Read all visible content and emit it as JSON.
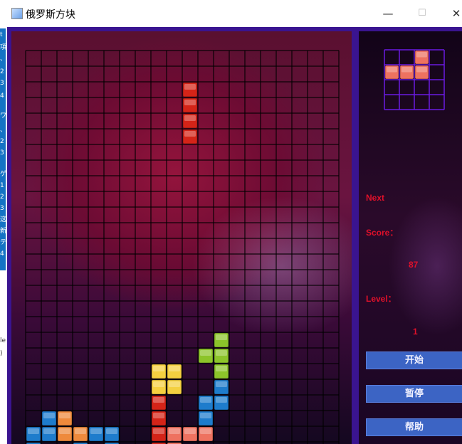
{
  "window": {
    "title": "俄罗斯方块",
    "minimize_glyph": "—",
    "maximize_glyph": "☐",
    "close_glyph": "✕",
    "icon": "java-cup-icon"
  },
  "background_window": {
    "fragments": [
      "t",
      "項",
      "、",
      "2",
      "3",
      "4",
      "ワ",
      "、",
      "2",
      "3",
      "ゲ",
      "1",
      "2",
      "3",
      "这",
      "新",
      "テ",
      "4"
    ],
    "lower_fragments": [
      "le",
      ")"
    ]
  },
  "board": {
    "cols": 20,
    "rows": 26,
    "blocks": [
      {
        "r": 2,
        "c": 10,
        "color": "red"
      },
      {
        "r": 3,
        "c": 10,
        "color": "red"
      },
      {
        "r": 4,
        "c": 10,
        "color": "red"
      },
      {
        "r": 5,
        "c": 10,
        "color": "red"
      },
      {
        "r": 18,
        "c": 12,
        "color": "green"
      },
      {
        "r": 19,
        "c": 11,
        "color": "green"
      },
      {
        "r": 19,
        "c": 12,
        "color": "green"
      },
      {
        "r": 20,
        "c": 12,
        "color": "green"
      },
      {
        "r": 20,
        "c": 8,
        "color": "yellow"
      },
      {
        "r": 20,
        "c": 9,
        "color": "yellow"
      },
      {
        "r": 21,
        "c": 8,
        "color": "yellow"
      },
      {
        "r": 21,
        "c": 9,
        "color": "yellow"
      },
      {
        "r": 21,
        "c": 12,
        "color": "blue"
      },
      {
        "r": 22,
        "c": 11,
        "color": "blue"
      },
      {
        "r": 22,
        "c": 12,
        "color": "blue"
      },
      {
        "r": 23,
        "c": 11,
        "color": "blue"
      },
      {
        "r": 22,
        "c": 8,
        "color": "red"
      },
      {
        "r": 23,
        "c": 8,
        "color": "red"
      },
      {
        "r": 24,
        "c": 8,
        "color": "red"
      },
      {
        "r": 24,
        "c": 9,
        "color": "salmon"
      },
      {
        "r": 24,
        "c": 10,
        "color": "salmon"
      },
      {
        "r": 24,
        "c": 11,
        "color": "salmon"
      },
      {
        "r": 23,
        "c": 1,
        "color": "blue"
      },
      {
        "r": 23,
        "c": 2,
        "color": "orange"
      },
      {
        "r": 24,
        "c": 0,
        "color": "blue"
      },
      {
        "r": 24,
        "c": 1,
        "color": "blue"
      },
      {
        "r": 24,
        "c": 2,
        "color": "orange"
      },
      {
        "r": 24,
        "c": 3,
        "color": "orange"
      },
      {
        "r": 24,
        "c": 4,
        "color": "blue"
      },
      {
        "r": 24,
        "c": 5,
        "color": "blue"
      },
      {
        "r": 25,
        "c": 0,
        "color": "blue"
      },
      {
        "r": 25,
        "c": 3,
        "color": "blue"
      },
      {
        "r": 25,
        "c": 5,
        "color": "blue"
      },
      {
        "r": 25,
        "c": 8,
        "color": "red"
      },
      {
        "r": 25,
        "c": 9,
        "color": "salmon"
      }
    ]
  },
  "preview": {
    "cols": 4,
    "rows": 3,
    "blocks": [
      {
        "r": 0,
        "c": 2,
        "color": "salmon"
      },
      {
        "r": 1,
        "c": 0,
        "color": "salmon"
      },
      {
        "r": 1,
        "c": 1,
        "color": "salmon"
      },
      {
        "r": 1,
        "c": 2,
        "color": "salmon"
      }
    ]
  },
  "side": {
    "next_label": "Next",
    "score_label": "Score：",
    "score_value": "87",
    "level_label": "Level：",
    "level_value": "1",
    "start_button": "开始",
    "pause_button": "暂停",
    "help_button": "帮助"
  },
  "colors": {
    "frame": "#3a1490",
    "label_text": "#e0102a",
    "button_fill": "#3c64c4",
    "red": "#d42418",
    "green": "#8cc42a",
    "yellow": "#f4d040",
    "blue": "#1e7ccc",
    "orange": "#ee8a3c",
    "salmon": "#ee7260"
  }
}
